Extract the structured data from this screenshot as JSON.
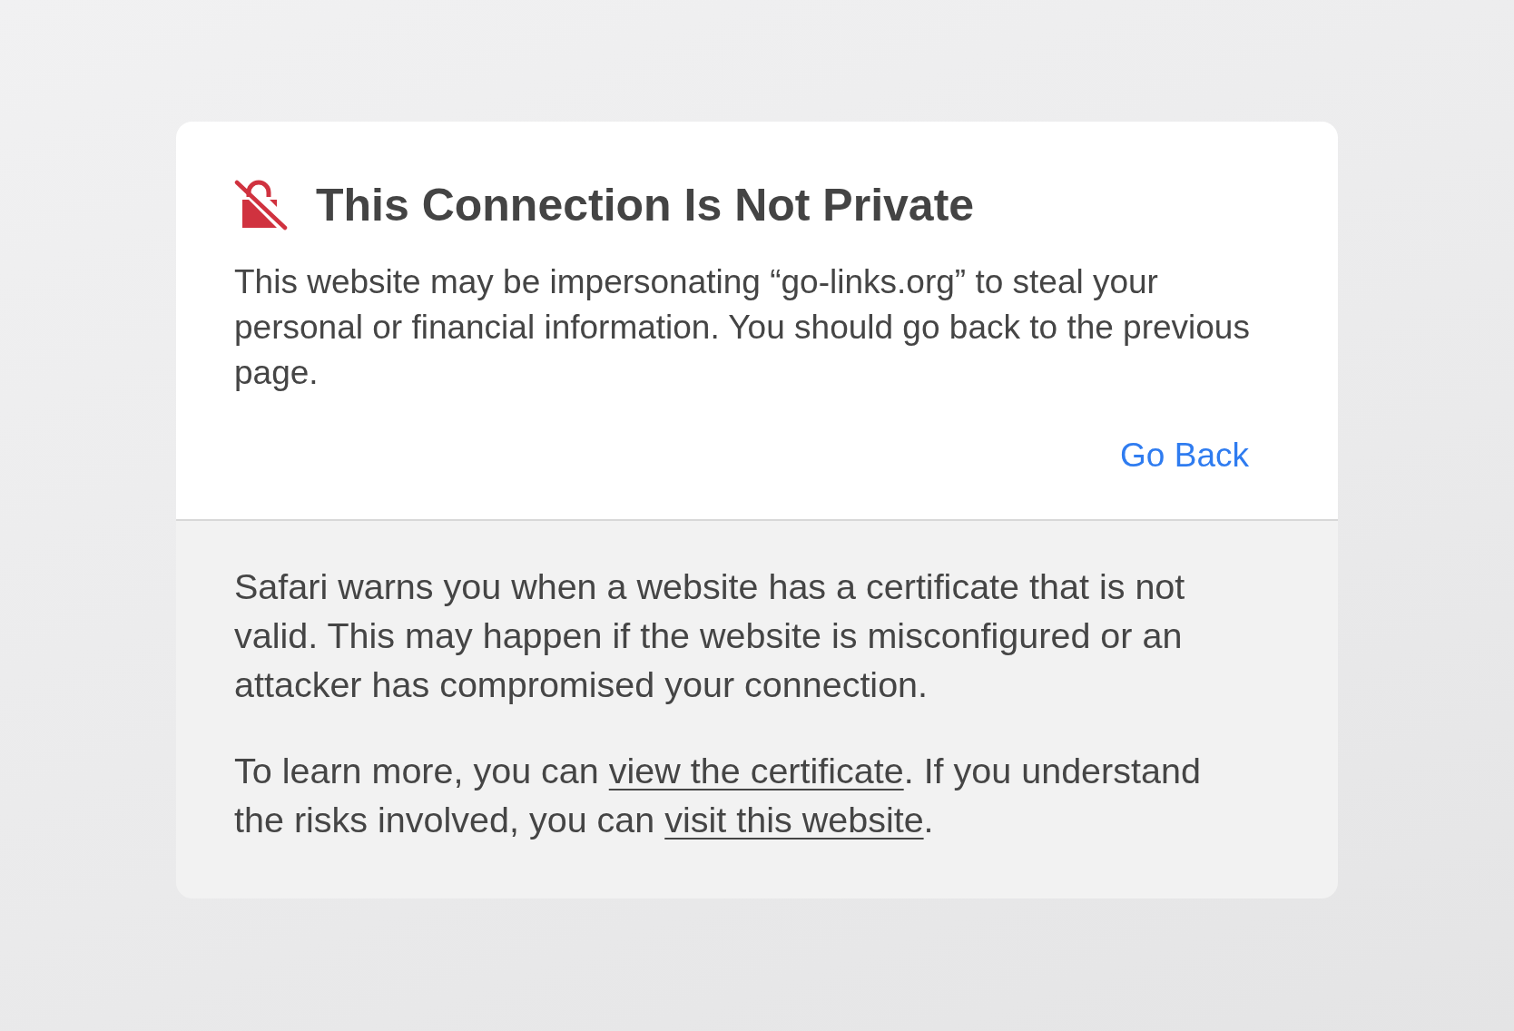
{
  "warning": {
    "title": "This Connection Is Not Private",
    "message": "This website may be impersonating “go-links.org” to steal your personal or financial information. You should go back to the previous page.",
    "go_back_button": "Go Back"
  },
  "details": {
    "paragraphs": [
      [
        {
          "kind": "text",
          "text": "Safari warns you when a website has a certificate that is not valid. This may happen if the website is misconfigured or an attacker has compromised your connection."
        }
      ],
      [
        {
          "kind": "text",
          "text": "To learn more, you can "
        },
        {
          "kind": "link",
          "text": "view the certificate"
        },
        {
          "kind": "text",
          "text": ". If you understand the risks involved, you can "
        },
        {
          "kind": "link",
          "text": "visit this website"
        },
        {
          "kind": "text",
          "text": "."
        }
      ]
    ]
  }
}
